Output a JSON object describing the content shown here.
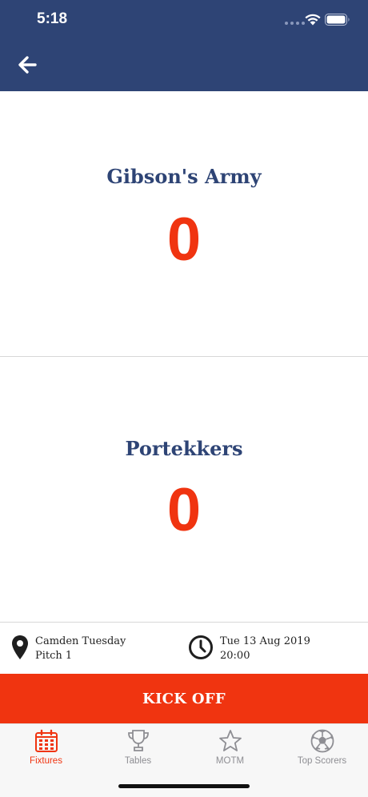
{
  "status_bar": {
    "time": "5:18"
  },
  "colors": {
    "navy": "#2e4475",
    "accent": "#f03410"
  },
  "header": {
    "back_icon": "arrow-left-icon"
  },
  "home_team": {
    "name": "Gibson's Army",
    "score": "0"
  },
  "away_team": {
    "name": "Portekkers",
    "score": "0"
  },
  "venue": {
    "icon": "map-pin-icon",
    "line1": "Camden Tuesday",
    "line2": "Pitch 1"
  },
  "schedule": {
    "icon": "clock-icon",
    "line1": "Tue 13 Aug 2019",
    "line2": "20:00"
  },
  "action": {
    "kickoff_label": "KICK OFF"
  },
  "tabs": [
    {
      "label": "Fixtures",
      "icon": "calendar-icon",
      "active": true
    },
    {
      "label": "Tables",
      "icon": "trophy-icon",
      "active": false
    },
    {
      "label": "MOTM",
      "icon": "star-icon",
      "active": false
    },
    {
      "label": "Top Scorers",
      "icon": "football-icon",
      "active": false
    }
  ]
}
